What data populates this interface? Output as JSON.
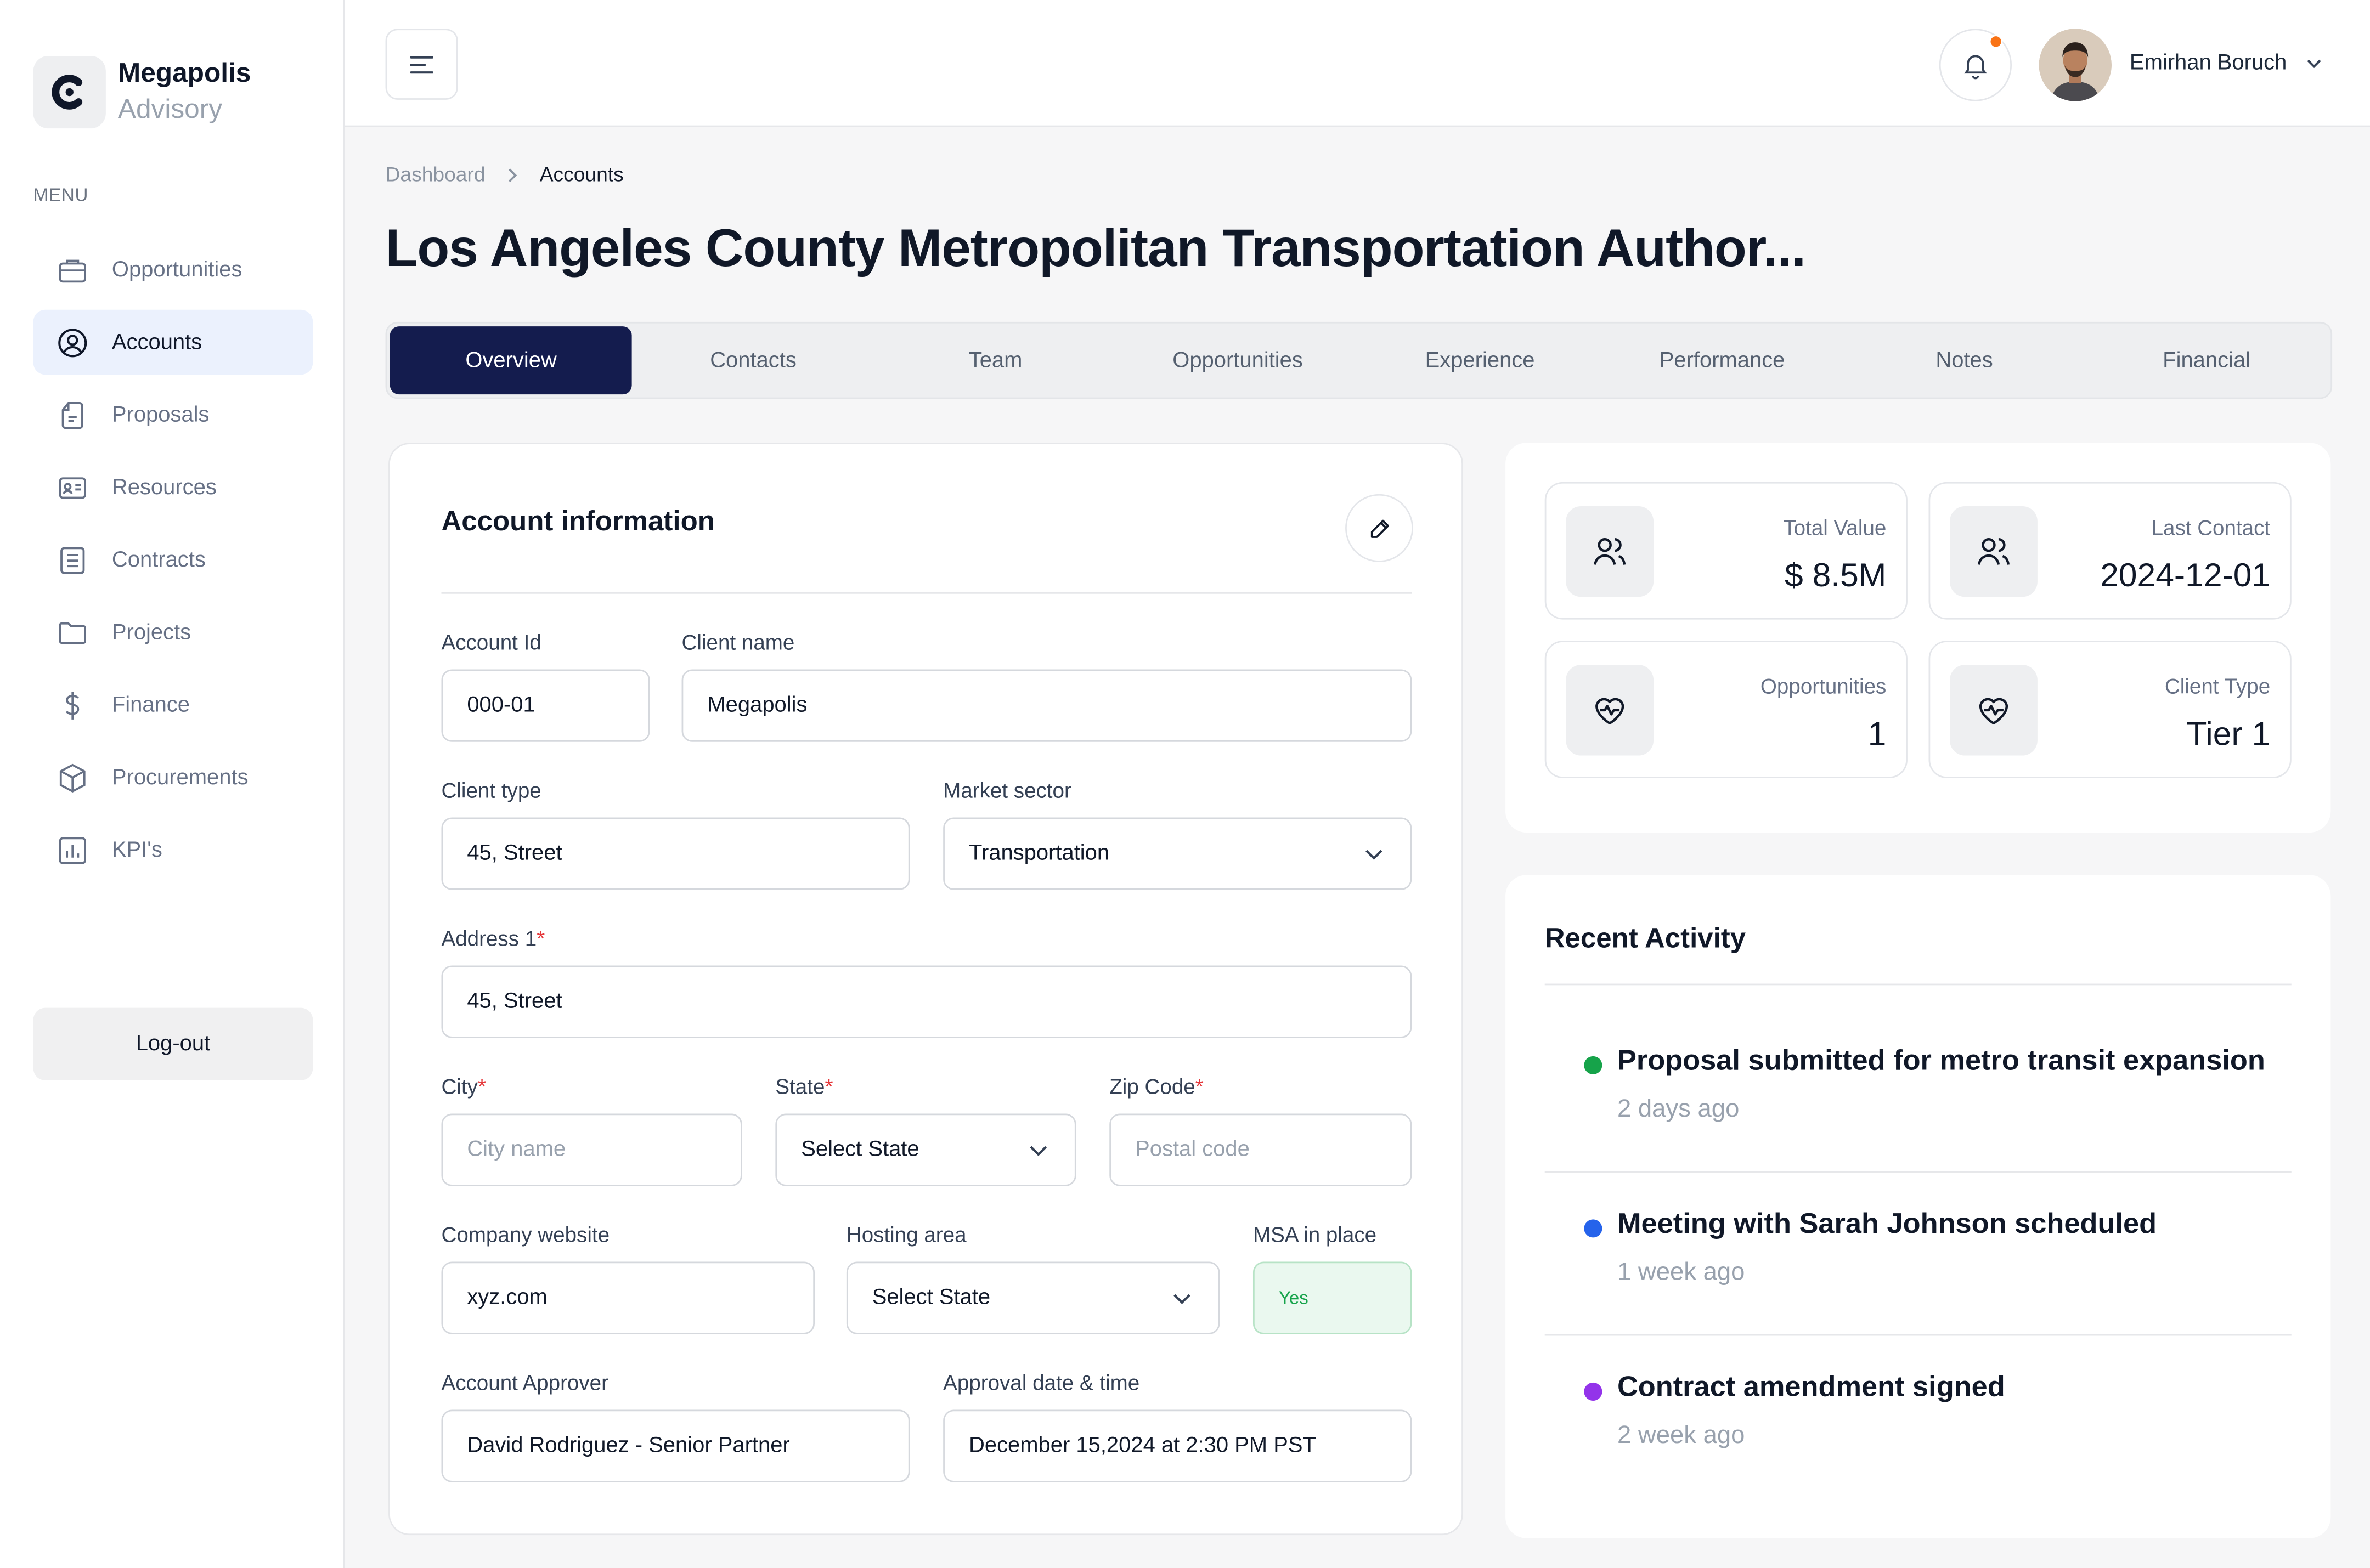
{
  "brand": {
    "name": "Megapolis",
    "sub": "Advisory"
  },
  "menu_label": "MENU",
  "nav": [
    {
      "label": "Opportunities",
      "icon": "briefcase-icon"
    },
    {
      "label": "Accounts",
      "icon": "user-circle-icon",
      "active": true
    },
    {
      "label": "Proposals",
      "icon": "document-icon"
    },
    {
      "label": "Resources",
      "icon": "id-card-icon"
    },
    {
      "label": "Contracts",
      "icon": "contract-icon"
    },
    {
      "label": "Projects",
      "icon": "folder-icon"
    },
    {
      "label": "Finance",
      "icon": "dollar-icon"
    },
    {
      "label": "Procurements",
      "icon": "box-icon"
    },
    {
      "label": "KPI's",
      "icon": "bar-chart-icon"
    }
  ],
  "logout_label": "Log-out",
  "user": {
    "name": "Emirhan Boruch",
    "has_notification": true
  },
  "breadcrumb": {
    "parent": "Dashboard",
    "current": "Accounts"
  },
  "page_title": "Los Angeles County Metropolitan Transportation Author...",
  "tabs": [
    "Overview",
    "Contacts",
    "Team",
    "Opportunities",
    "Experience",
    "Performance",
    "Notes",
    "Financial"
  ],
  "active_tab": "Overview",
  "account_info": {
    "title": "Account information",
    "account_id": {
      "label": "Account Id",
      "value": "000-01"
    },
    "client_name": {
      "label": "Client name",
      "value": "Megapolis"
    },
    "client_type": {
      "label": "Client type",
      "value": "45, Street"
    },
    "market_sector": {
      "label": "Market sector",
      "value": "Transportation"
    },
    "address1": {
      "label": "Address 1",
      "required": "*",
      "value": "45, Street"
    },
    "city": {
      "label": "City",
      "required": "*",
      "placeholder": "City name"
    },
    "state": {
      "label": "State",
      "required": "*",
      "value": "Select State"
    },
    "zip": {
      "label": "Zip Code",
      "required": "*",
      "placeholder": "Postal code"
    },
    "website": {
      "label": "Company website",
      "value": "xyz.com"
    },
    "hosting": {
      "label": "Hosting area",
      "value": "Select State"
    },
    "msa": {
      "label": "MSA in place",
      "value": "Yes"
    },
    "approver": {
      "label": "Account Approver",
      "value": "David Rodriguez - Senior Partner"
    },
    "approval_date": {
      "label": "Approval date & time",
      "value": "December 15,2024 at 2:30 PM PST"
    }
  },
  "stats": [
    {
      "label": "Total Value",
      "value": "$ 8.5M",
      "icon": "users-icon"
    },
    {
      "label": "Last Contact",
      "value": "2024-12-01",
      "icon": "users-icon"
    },
    {
      "label": "Opportunities",
      "value": "1",
      "icon": "heart-pulse-icon"
    },
    {
      "label": "Client Type",
      "value": "Tier 1",
      "icon": "heart-pulse-icon"
    }
  ],
  "recent_activity": {
    "title": "Recent Activity",
    "items": [
      {
        "text": "Proposal submitted for metro transit expansion",
        "time": "2 days ago",
        "color": "#16a34a"
      },
      {
        "text": "Meeting with Sarah Johnson scheduled",
        "time": "1 week ago",
        "color": "#2563eb"
      },
      {
        "text": "Contract amendment signed",
        "time": "2 week ago",
        "color": "#9333ea"
      }
    ]
  },
  "colors": {
    "accent": "#141c4e",
    "active_nav_bg": "#ebf1fd",
    "required": "#e5383b",
    "notification": "#f97316"
  }
}
